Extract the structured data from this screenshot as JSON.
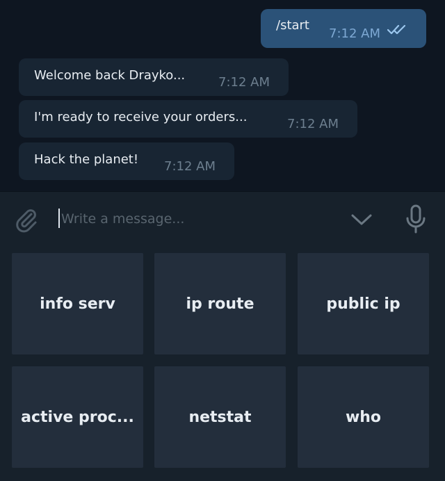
{
  "messages": [
    {
      "direction": "out",
      "text": "/start",
      "time": "7:12 AM",
      "status": "double-check-icon"
    },
    {
      "direction": "in",
      "text": "Welcome back Drayko...",
      "time": "7:12 AM"
    },
    {
      "direction": "in",
      "text": "I'm ready to receive your orders...",
      "time": "7:12 AM"
    },
    {
      "direction": "in",
      "text": "Hack the planet!",
      "time": "7:12 AM"
    }
  ],
  "composer": {
    "placeholder": "Write a message...",
    "value": "",
    "attach_icon": "paperclip-icon",
    "keyboard_toggle_icon": "chevron-down-icon",
    "voice_icon": "microphone-icon"
  },
  "keyboard": {
    "buttons": [
      {
        "label": "info serv"
      },
      {
        "label": "ip route"
      },
      {
        "label": "public ip"
      },
      {
        "label": "active proc..."
      },
      {
        "label": "netstat"
      },
      {
        "label": "who"
      }
    ]
  },
  "colors": {
    "chat_background": "#0e1621",
    "incoming_bubble": "#182533",
    "outgoing_bubble": "#2b5278",
    "composer_background": "#17212b",
    "key_background": "#232e3c",
    "read_check": "#9cc7ee"
  }
}
